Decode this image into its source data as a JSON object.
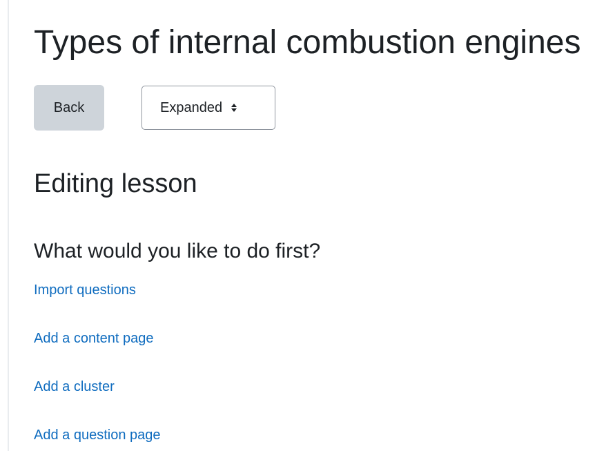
{
  "page": {
    "title": "Types of internal combustion engines"
  },
  "toolbar": {
    "back_label": "Back",
    "view_mode": {
      "selected": "Expanded"
    }
  },
  "main": {
    "section_heading": "Editing lesson",
    "prompt": "What would you like to do first?",
    "actions": [
      {
        "label": "Import questions"
      },
      {
        "label": "Add a content page"
      },
      {
        "label": "Add a cluster"
      },
      {
        "label": "Add a question page"
      }
    ]
  },
  "colors": {
    "link": "#0f6cbf",
    "button_bg": "#ced4da",
    "text": "#1d2125"
  }
}
